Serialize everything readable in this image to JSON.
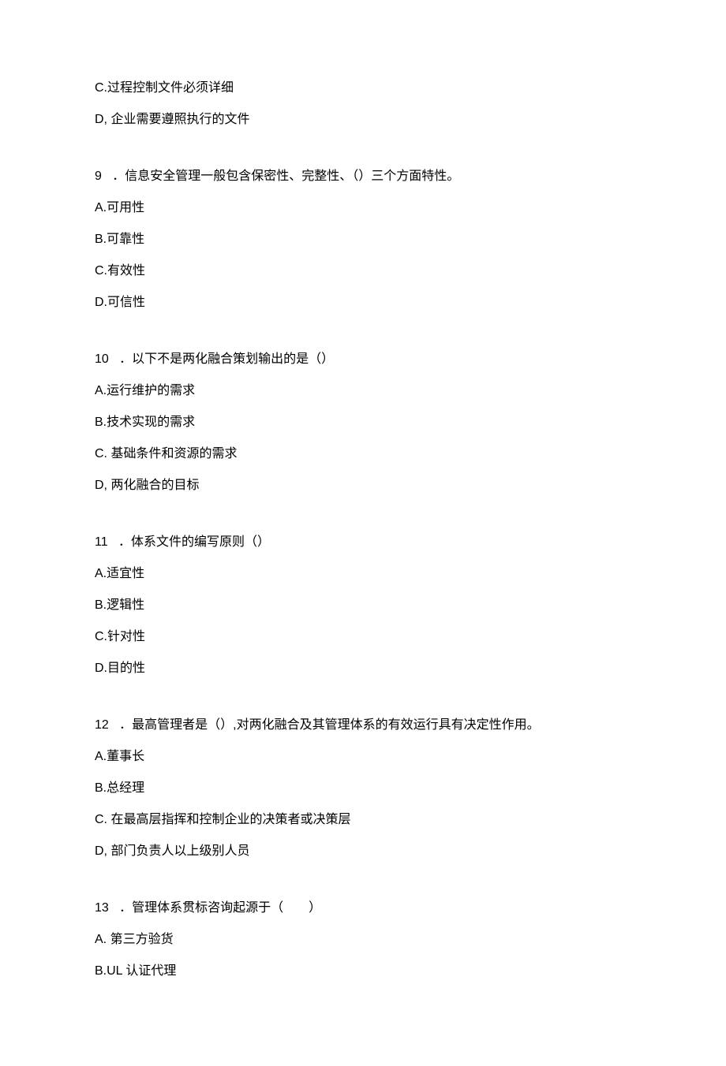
{
  "leading_options": [
    {
      "label": "C.",
      "text": "过程控制文件必须详细"
    },
    {
      "label": "D,",
      "text": "企业需要遵照执行的文件"
    }
  ],
  "questions": [
    {
      "number": "9",
      "separator": "．",
      "text": "信息安全管理一般包含保密性、完整性、（）三个方面特性。",
      "options": [
        {
          "label": "A.",
          "text": "可用性"
        },
        {
          "label": "B.",
          "text": "可靠性"
        },
        {
          "label": "C.",
          "text": "有效性"
        },
        {
          "label": "D.",
          "text": "可信性"
        }
      ]
    },
    {
      "number": "10",
      "separator": "．",
      "text": "以下不是两化融合策划输出的是（）",
      "options": [
        {
          "label": "A.",
          "text": "运行维护的需求"
        },
        {
          "label": "B.",
          "text": "技术实现的需求"
        },
        {
          "label": "C.",
          "text": "基础条件和资源的需求"
        },
        {
          "label": "D,",
          "text": "两化融合的目标"
        }
      ]
    },
    {
      "number": "11",
      "separator": "．",
      "text": "体系文件的编写原则（）",
      "options": [
        {
          "label": "A.",
          "text": "适宜性"
        },
        {
          "label": "B.",
          "text": "逻辑性"
        },
        {
          "label": "C.",
          "text": "针对性"
        },
        {
          "label": "D.",
          "text": "目的性"
        }
      ]
    },
    {
      "number": "12",
      "separator": "．",
      "text": "最高管理者是（）,对两化融合及其管理体系的有效运行具有决定性作用。",
      "options": [
        {
          "label": "A.",
          "text": "董事长"
        },
        {
          "label": "B.",
          "text": "总经理"
        },
        {
          "label": "C.",
          "text": "在最高层指挥和控制企业的决策者或决策层"
        },
        {
          "label": "D,",
          "text": "部门负责人以上级别人员"
        }
      ]
    },
    {
      "number": "13",
      "separator": "．",
      "text": "管理体系贯标咨询起源于（　　）",
      "options": [
        {
          "label": "A.",
          "text": "第三方验货"
        },
        {
          "label": "B.",
          "text": "UL 认证代理"
        }
      ]
    }
  ]
}
